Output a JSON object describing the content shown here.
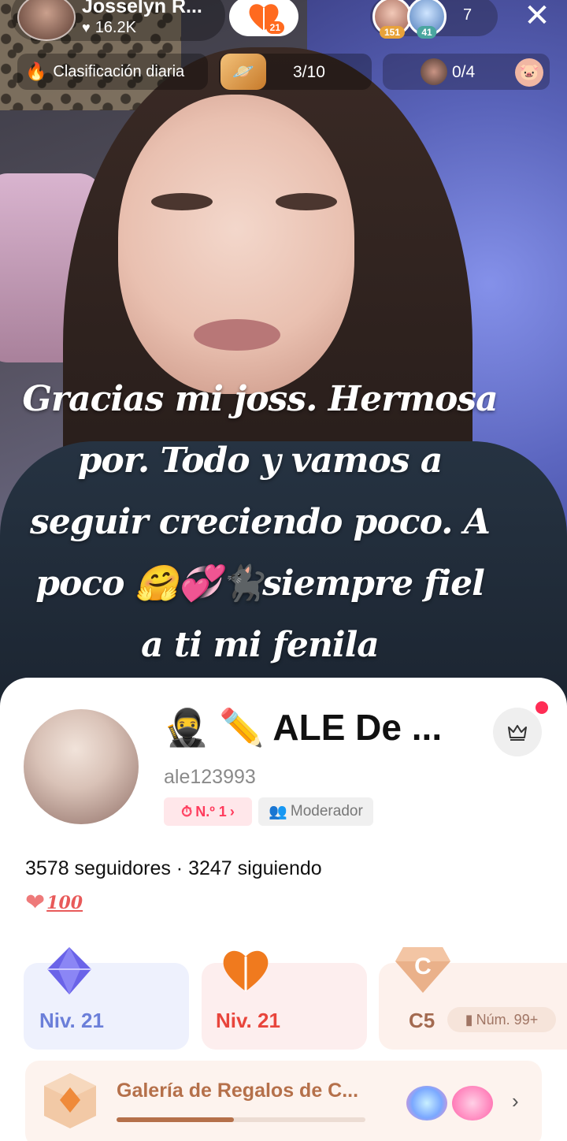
{
  "host": {
    "name": "Josselyn R...",
    "likes": "16.2K",
    "team_level": "21"
  },
  "viewers": {
    "top1_level": "151",
    "top2_level": "41",
    "count": "7"
  },
  "rank_bar": {
    "daily_label": "Clasificación diaria",
    "pk_progress": "3/10",
    "match_progress": "0/4"
  },
  "caption": {
    "lines": [
      "Gracias mi joss. Hermosa",
      "por. Todo y vamos a",
      "seguir creciendo poco. A",
      "poco 🤗💞🐈‍⬛siempre fiel",
      "a ti mi fenila"
    ]
  },
  "profile": {
    "display_name": "🥷 ✏️ ALE  De ...",
    "handle": "ale123993",
    "rank_tag": "N.º 1",
    "role_tag": "Moderador",
    "follow_stats": "3578 seguidores · 3247 siguiendo",
    "fan_badge": "100",
    "cards": {
      "gift_level": "Niv. 21",
      "team_level": "Niv. 21",
      "class_label": "C5",
      "class_rank": "Núm. 99+"
    },
    "gallery": {
      "title": "Galería de Regalos de C...",
      "progress": 0.47
    }
  },
  "colors": {
    "gift_level": "#6b7fd9",
    "team_level": "#e8453c",
    "class": "#a36a50",
    "gallery_title": "#b5704a"
  }
}
